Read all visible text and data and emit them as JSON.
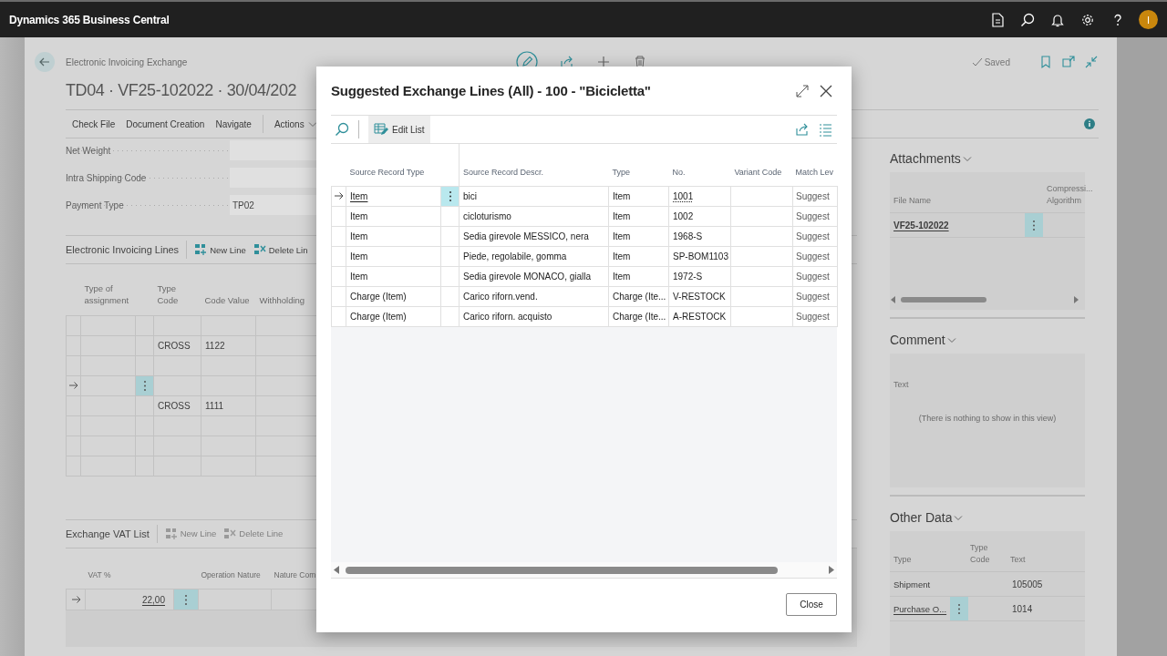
{
  "app_bar": {
    "title": "Dynamics 365 Business Central",
    "avatar": "I"
  },
  "page": {
    "breadcrumb": "Electronic Invoicing Exchange",
    "title": "TD04 · VF25-102022 · 30/04/202",
    "status": "Saved",
    "actions": [
      {
        "label": "Check File",
        "kind": "action"
      },
      {
        "label": "Document Creation",
        "kind": "action"
      },
      {
        "label": "Navigate",
        "kind": "action"
      },
      {
        "label": "Actions",
        "kind": "menu"
      }
    ],
    "fields": [
      {
        "label": "Net Weight"
      },
      {
        "label": "Intra Shipping Code"
      },
      {
        "label": "Payment Type",
        "value": "TP02"
      }
    ],
    "lines": {
      "title": "Electronic Invoicing Lines",
      "actions": [
        {
          "label": "New Line",
          "kind": "new",
          "disabled": false
        },
        {
          "label": "Delete Lin",
          "kind": "delete",
          "disabled": false
        }
      ],
      "columns": [
        "Type of assignment",
        "Type Code",
        "Code Value",
        "Withholding"
      ],
      "rows": [
        {
          "selected": false
        },
        {
          "type_code": "CROSS",
          "code_value": "1122",
          "selected": false
        },
        {
          "selected": false
        },
        {
          "selected": true
        },
        {
          "type_code": "CROSS",
          "code_value": "1111",
          "selected": false
        },
        {
          "selected": false
        },
        {
          "selected": false
        },
        {
          "selected": false
        }
      ]
    },
    "vat": {
      "title": "Exchange VAT List",
      "actions": [
        {
          "label": "New Line",
          "kind": "new",
          "disabled": true
        },
        {
          "label": "Delete Line",
          "kind": "delete",
          "disabled": true
        }
      ],
      "columns": [
        "VAT %",
        "Operation Nature",
        "Nature Com"
      ],
      "rows": [
        {
          "vat_percent": "22,00",
          "selected": true
        }
      ]
    }
  },
  "factbox": {
    "attachments": {
      "title": "Attachments",
      "columns": [
        "File Name",
        "Compressi... Algorithm"
      ],
      "rows": [
        {
          "file_name": "VF25-102022",
          "selected": true
        }
      ]
    },
    "comment": {
      "title": "Comment",
      "columns": [
        "Text"
      ],
      "empty_text": "(There is nothing to show in this view)"
    },
    "other_data": {
      "title": "Other Data",
      "columns": [
        "Type",
        "Type Code",
        "Text"
      ],
      "rows": [
        {
          "type": "Shipment",
          "text": "105005",
          "selected": false
        },
        {
          "type": "Purchase O...",
          "text": "1014",
          "selected": true
        }
      ]
    }
  },
  "dialog": {
    "title": "Suggested Exchange Lines (All) - 100 - \"Bicicletta\"",
    "edit_list": "Edit List",
    "columns": [
      "Source Record Type",
      "Source Record Descr.",
      "Type",
      "No.",
      "Variant Code",
      "Match Lev"
    ],
    "rows": [
      {
        "source_record_type": "Item",
        "source_record_descr": "bici",
        "type": "Item",
        "no": "1001",
        "match_level": "Suggest",
        "selected": true
      },
      {
        "source_record_type": "Item",
        "source_record_descr": "cicloturismo",
        "type": "Item",
        "no": "1002",
        "match_level": "Suggest",
        "selected": false
      },
      {
        "source_record_type": "Item",
        "source_record_descr": "Sedia girevole MESSICO, nera",
        "type": "Item",
        "no": "1968-S",
        "match_level": "Suggest",
        "selected": false
      },
      {
        "source_record_type": "Item",
        "source_record_descr": "Piede, regolabile, gomma",
        "type": "Item",
        "no": "SP-BOM1103",
        "match_level": "Suggest",
        "selected": false
      },
      {
        "source_record_type": "Item",
        "source_record_descr": "Sedia girevole MONACO, gialla",
        "type": "Item",
        "no": "1972-S",
        "match_level": "Suggest",
        "selected": false
      },
      {
        "source_record_type": "Charge (Item)",
        "source_record_descr": "Carico riforn.vend.",
        "type": "Charge (Ite...",
        "no": "V-RESTOCK",
        "match_level": "Suggest",
        "selected": false
      },
      {
        "source_record_type": "Charge (Item)",
        "source_record_descr": "Carico riforn. acquisto",
        "type": "Charge (Ite...",
        "no": "A-RESTOCK",
        "match_level": "Suggest",
        "selected": false
      }
    ],
    "close": "Close"
  }
}
